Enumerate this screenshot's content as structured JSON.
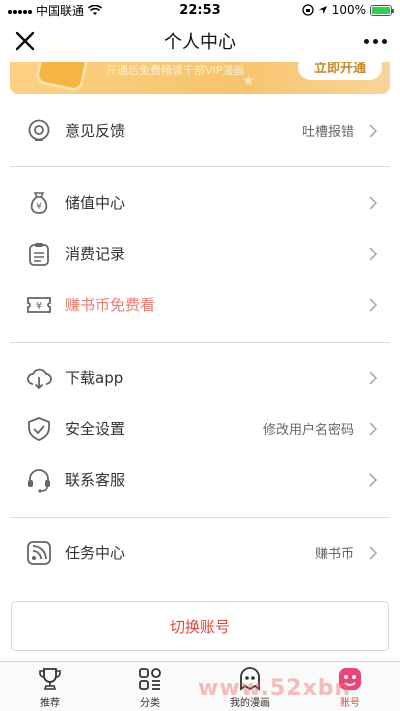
{
  "status_bar": {
    "carrier": "中国联通",
    "time": "22:53",
    "battery": "100%",
    "battery_level": 1.0
  },
  "nav": {
    "title": "个人中心",
    "close_icon": "close-icon",
    "more_icon": "more-icon"
  },
  "vip_banner": {
    "text": "开通后免费畅读千部VIP漫画",
    "button_label": "立即开通"
  },
  "menu_groups": {
    "feedback": {
      "label": "意见反馈",
      "value": "吐槽报错",
      "icon": "feedback-icon"
    },
    "recharge": {
      "label": "储值中心",
      "icon": "money-bag-icon"
    },
    "consume": {
      "label": "消费记录",
      "icon": "clipboard-icon"
    },
    "free_coin": {
      "label": "赚书币免费看",
      "icon": "coin-ticket-icon"
    },
    "download": {
      "label": "下载app",
      "icon": "cloud-download-icon"
    },
    "security": {
      "label": "安全设置",
      "value": "修改用户名密码",
      "icon": "shield-icon"
    },
    "service": {
      "label": "联系客服",
      "icon": "headset-icon"
    },
    "tasks": {
      "label": "任务中心",
      "value": "赚书币",
      "icon": "rss-icon"
    }
  },
  "switch_account": {
    "label": "切换账号"
  },
  "tab_bar": {
    "tabs": [
      {
        "label": "推荐",
        "icon": "trophy-icon",
        "active": false
      },
      {
        "label": "分类",
        "icon": "category-icon",
        "active": false
      },
      {
        "label": "我的漫画",
        "icon": "ghost-icon",
        "active": false
      },
      {
        "label": "账号",
        "icon": "account-icon",
        "active": true
      }
    ]
  },
  "watermark": "www.52xbn",
  "colors": {
    "accent_red": "#e0483c",
    "pink_label": "#ef7a6e",
    "vip_gold": "#f7c46d"
  }
}
